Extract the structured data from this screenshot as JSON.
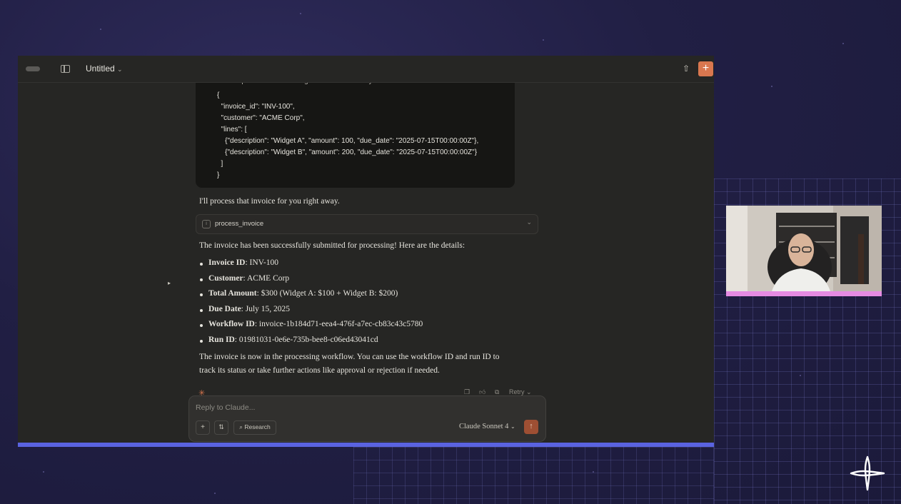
{
  "window": {
    "title": "Untitled",
    "title_chevron": "⌄",
    "new_chat_symbol": "+",
    "share_symbol": "⇧"
  },
  "conversation": {
    "user_message": {
      "intro": "Please process the following invoice immediately:",
      "code_lines": [
        "{",
        "  \"invoice_id\": \"INV-100\",",
        "  \"customer\": \"ACME Corp\",",
        "  \"lines\": [",
        "    {\"description\": \"Widget A\", \"amount\": 100, \"due_date\": \"2025-07-15T00:00:00Z\"},",
        "    {\"description\": \"Widget B\", \"amount\": 200, \"due_date\": \"2025-07-15T00:00:00Z\"}",
        "  ]",
        "}"
      ]
    },
    "assistant": {
      "lead": "I'll process that invoice for you right away.",
      "tool_call": {
        "icon": "tool-icon",
        "name": "process_invoice"
      },
      "summary": "The invoice has been successfully submitted for processing! Here are the details:",
      "details": [
        {
          "label": "Invoice ID",
          "value": ": INV-100"
        },
        {
          "label": "Customer",
          "value": ": ACME Corp"
        },
        {
          "label": "Total Amount",
          "value": ": $300 (Widget A: $100 + Widget B: $200)"
        },
        {
          "label": "Due Date",
          "value": ": July 15, 2025"
        },
        {
          "label": "Workflow ID",
          "value": ": invoice-1b184d71-eea4-476f-a7ec-cb83c43c5780"
        },
        {
          "label": "Run ID",
          "value": ": 01981031-0e6e-735b-bee8-c06ed43041cd"
        }
      ],
      "closing_line1": "The invoice is now in the processing workflow. You can use the workflow ID and run ID to",
      "closing_line2": "track its status or take further actions like approval or rejection if needed.",
      "retry_label": "Retry",
      "retry_chevron": "⌄"
    }
  },
  "composer": {
    "placeholder": "Reply to Claude...",
    "add_symbol": "+",
    "research_label": "Research",
    "model_label": "Claude Sonnet 4",
    "model_chevron": "⌄",
    "send_symbol": "↑"
  },
  "colors": {
    "accent": "#d9774f",
    "window_bg": "#262624",
    "code_bg": "#161614",
    "frame_bar": "#5a63e0",
    "cam_bar": "#e58be2"
  }
}
